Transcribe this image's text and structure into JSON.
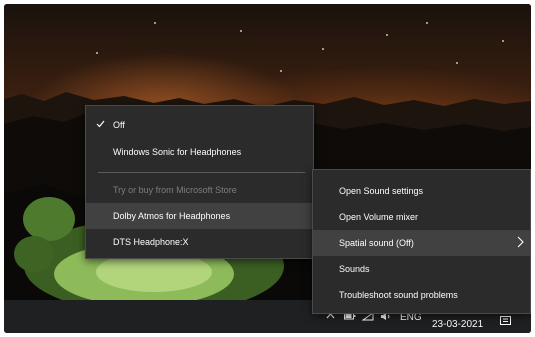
{
  "spatial_menu": {
    "items": [
      {
        "label": "Off",
        "checked": true,
        "enabled": true
      },
      {
        "label": "Windows Sonic for Headphones",
        "enabled": true
      },
      {
        "label": "Try or buy from Microsoft Store",
        "enabled": false
      },
      {
        "label": "Dolby Atmos for Headphones",
        "enabled": true,
        "highlighted": true
      },
      {
        "label": "DTS Headphone:X",
        "enabled": true
      }
    ]
  },
  "sound_menu": {
    "items": [
      {
        "label": "Open Sound settings"
      },
      {
        "label": "Open Volume mixer"
      },
      {
        "label": "Spatial sound (Off)",
        "highlighted": true,
        "has_submenu": true
      },
      {
        "label": "Sounds"
      },
      {
        "label": "Troubleshoot sound problems"
      }
    ]
  },
  "taskbar": {
    "language": "ENG",
    "date": "23-03-2021",
    "tray_icons": [
      "chevron-up-icon",
      "battery-icon",
      "network-icon",
      "volume-icon",
      "notification-icon"
    ]
  },
  "colors": {
    "menu_bg": "#2b2b2b",
    "menu_highlight": "#414141",
    "disabled_text": "#7d7d7d",
    "taskbar_bg": "#1f2022"
  }
}
